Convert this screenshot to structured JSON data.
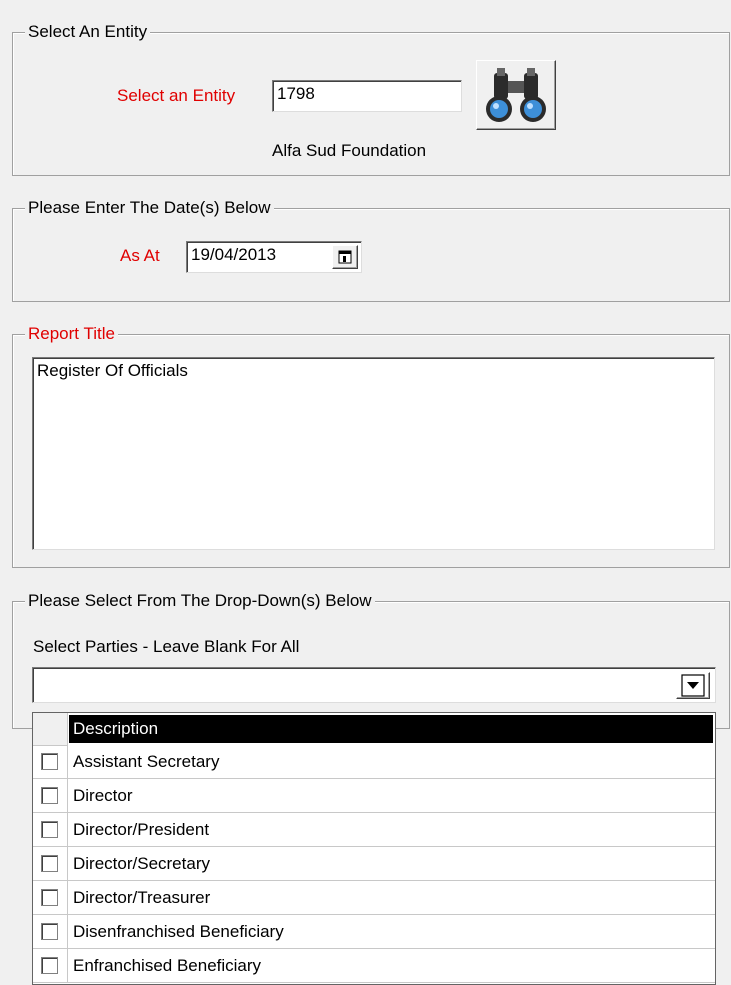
{
  "entity_group": {
    "legend": "Select An Entity",
    "label": "Select an Entity",
    "value": "1798",
    "name": "Alfa Sud Foundation",
    "lookup_icon": "binoculars-icon"
  },
  "date_group": {
    "legend": "Please Enter The Date(s) Below",
    "label": "As At",
    "value": "19/04/2013",
    "calendar_icon": "calendar-icon"
  },
  "title_group": {
    "legend": "Report Title",
    "value": "Register Of Officials"
  },
  "dropdown_group": {
    "legend": "Please Select From The Drop-Down(s) Below",
    "label": "Select Parties - Leave Blank For All",
    "value": "",
    "arrow_icon": "dropdown-arrow-icon"
  },
  "list": {
    "header": "Description",
    "items": [
      "Assistant Secretary",
      "Director",
      "Director/President",
      "Director/Secretary",
      "Director/Treasurer",
      "Disenfranchised Beneficiary",
      "Enfranchised Beneficiary"
    ]
  },
  "colors": {
    "label_red": "#e00000",
    "header_bg": "#000000"
  }
}
